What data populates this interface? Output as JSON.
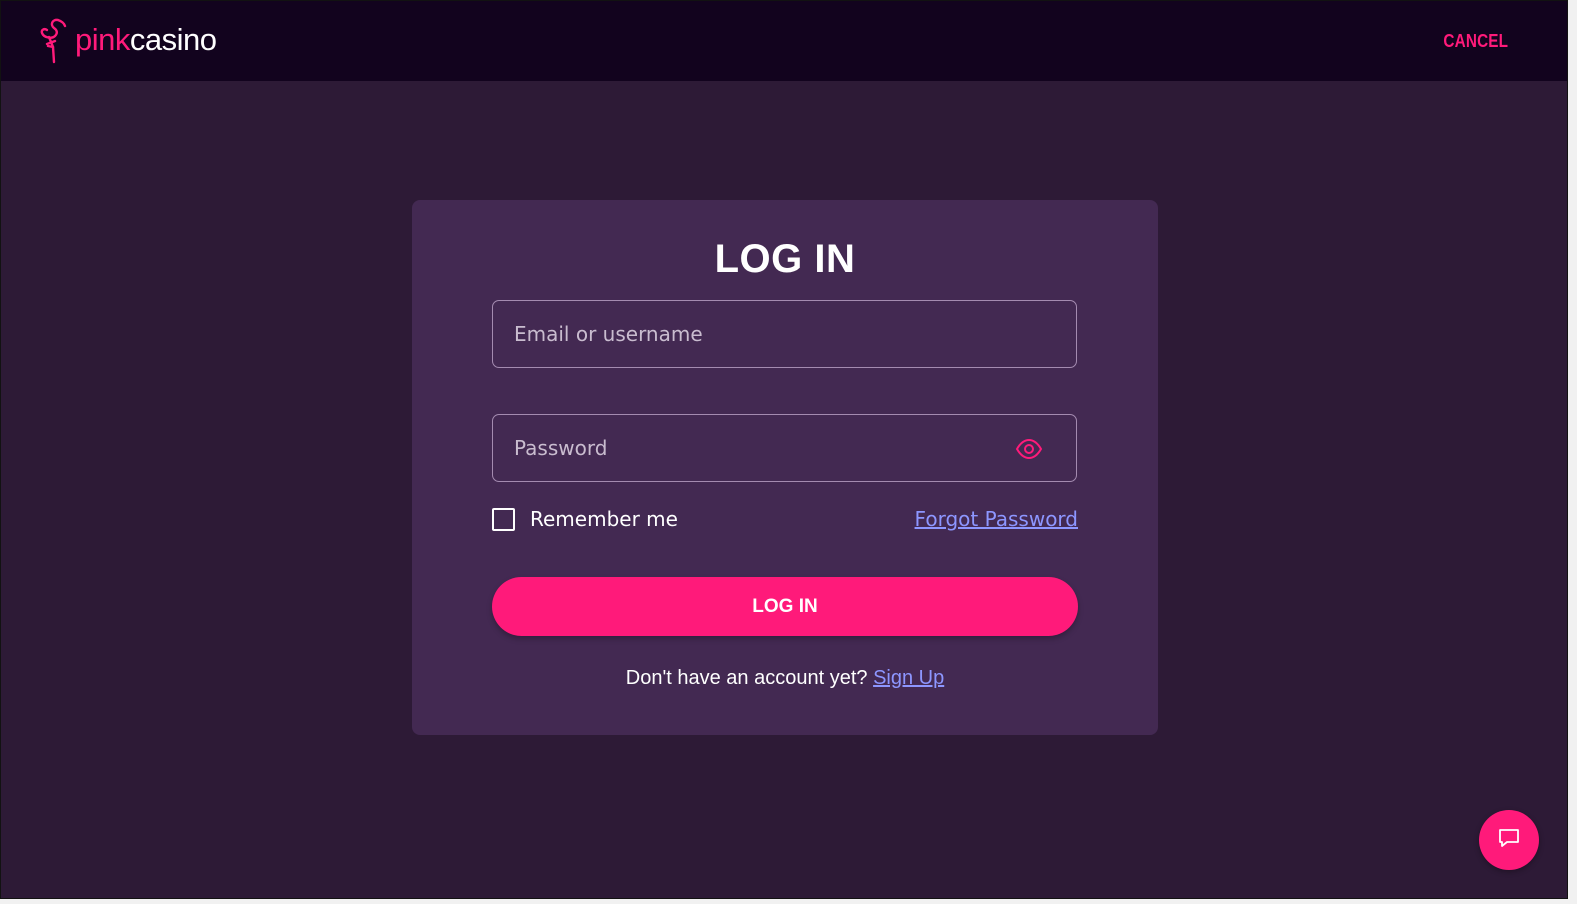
{
  "header": {
    "logo_part1": "pink",
    "logo_part2": "casino",
    "logo_icon": "flamingo-icon",
    "cancel_label": "CANCEL"
  },
  "login_card": {
    "title": "LOG IN",
    "email_placeholder": "Email or username",
    "email_value": "",
    "password_placeholder": "Password",
    "password_value": "",
    "password_toggle_icon": "eye-icon",
    "remember_label": "Remember me",
    "remember_checked": false,
    "forgot_label": "Forgot Password",
    "submit_label": "LOG IN",
    "signup_prompt": "Don't have an account yet?",
    "signup_label": "Sign Up"
  },
  "chat": {
    "icon": "chat-icon"
  },
  "colors": {
    "accent": "#ff1a7a",
    "link": "#8d96ff",
    "page_bg": "#2d1a36",
    "header_bg": "#12031e",
    "card_bg": "#432952"
  }
}
